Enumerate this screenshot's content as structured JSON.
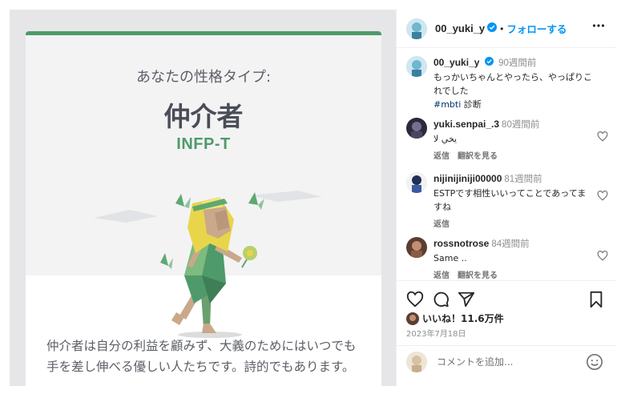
{
  "post_image": {
    "type_label": "あなたの性格タイプ:",
    "type_name": "仲介者",
    "type_code": "INFP-T",
    "description": "仲介者は自分の利益を顧みず、大義のためにはいつでも手を差し伸べる優しい人たちです。詩的でもあります。",
    "accent_color": "#4f9a6a"
  },
  "header": {
    "username": "00_yuki_y",
    "separator": "•",
    "follow_label": "フォローする",
    "more_icon": "more-horizontal-icon"
  },
  "caption": {
    "username": "00_yuki_y",
    "time": "90週間前",
    "text": "もっかいちゃんとやったら、やっぱりこれでした",
    "hashtag": "#mbti",
    "text_after": " 診断"
  },
  "comments": [
    {
      "username": "yuki.senpai_.3",
      "time": "80週間前",
      "text": "يخي لا",
      "reply": "返信",
      "translate": "翻訳を見る"
    },
    {
      "username": "nijinijiniji00000",
      "time": "81週間前",
      "text": "ESTPです相性いいってことであってますね",
      "reply": "返信",
      "translate": ""
    },
    {
      "username": "rossnotrose",
      "time": "84週間前",
      "text": "Same ..",
      "reply": "返信",
      "translate": "翻訳を見る"
    }
  ],
  "actions": {
    "likes": "いいね！11.6万件",
    "date": "2023年7月18日"
  },
  "add_comment": {
    "placeholder": "コメントを追加..."
  }
}
